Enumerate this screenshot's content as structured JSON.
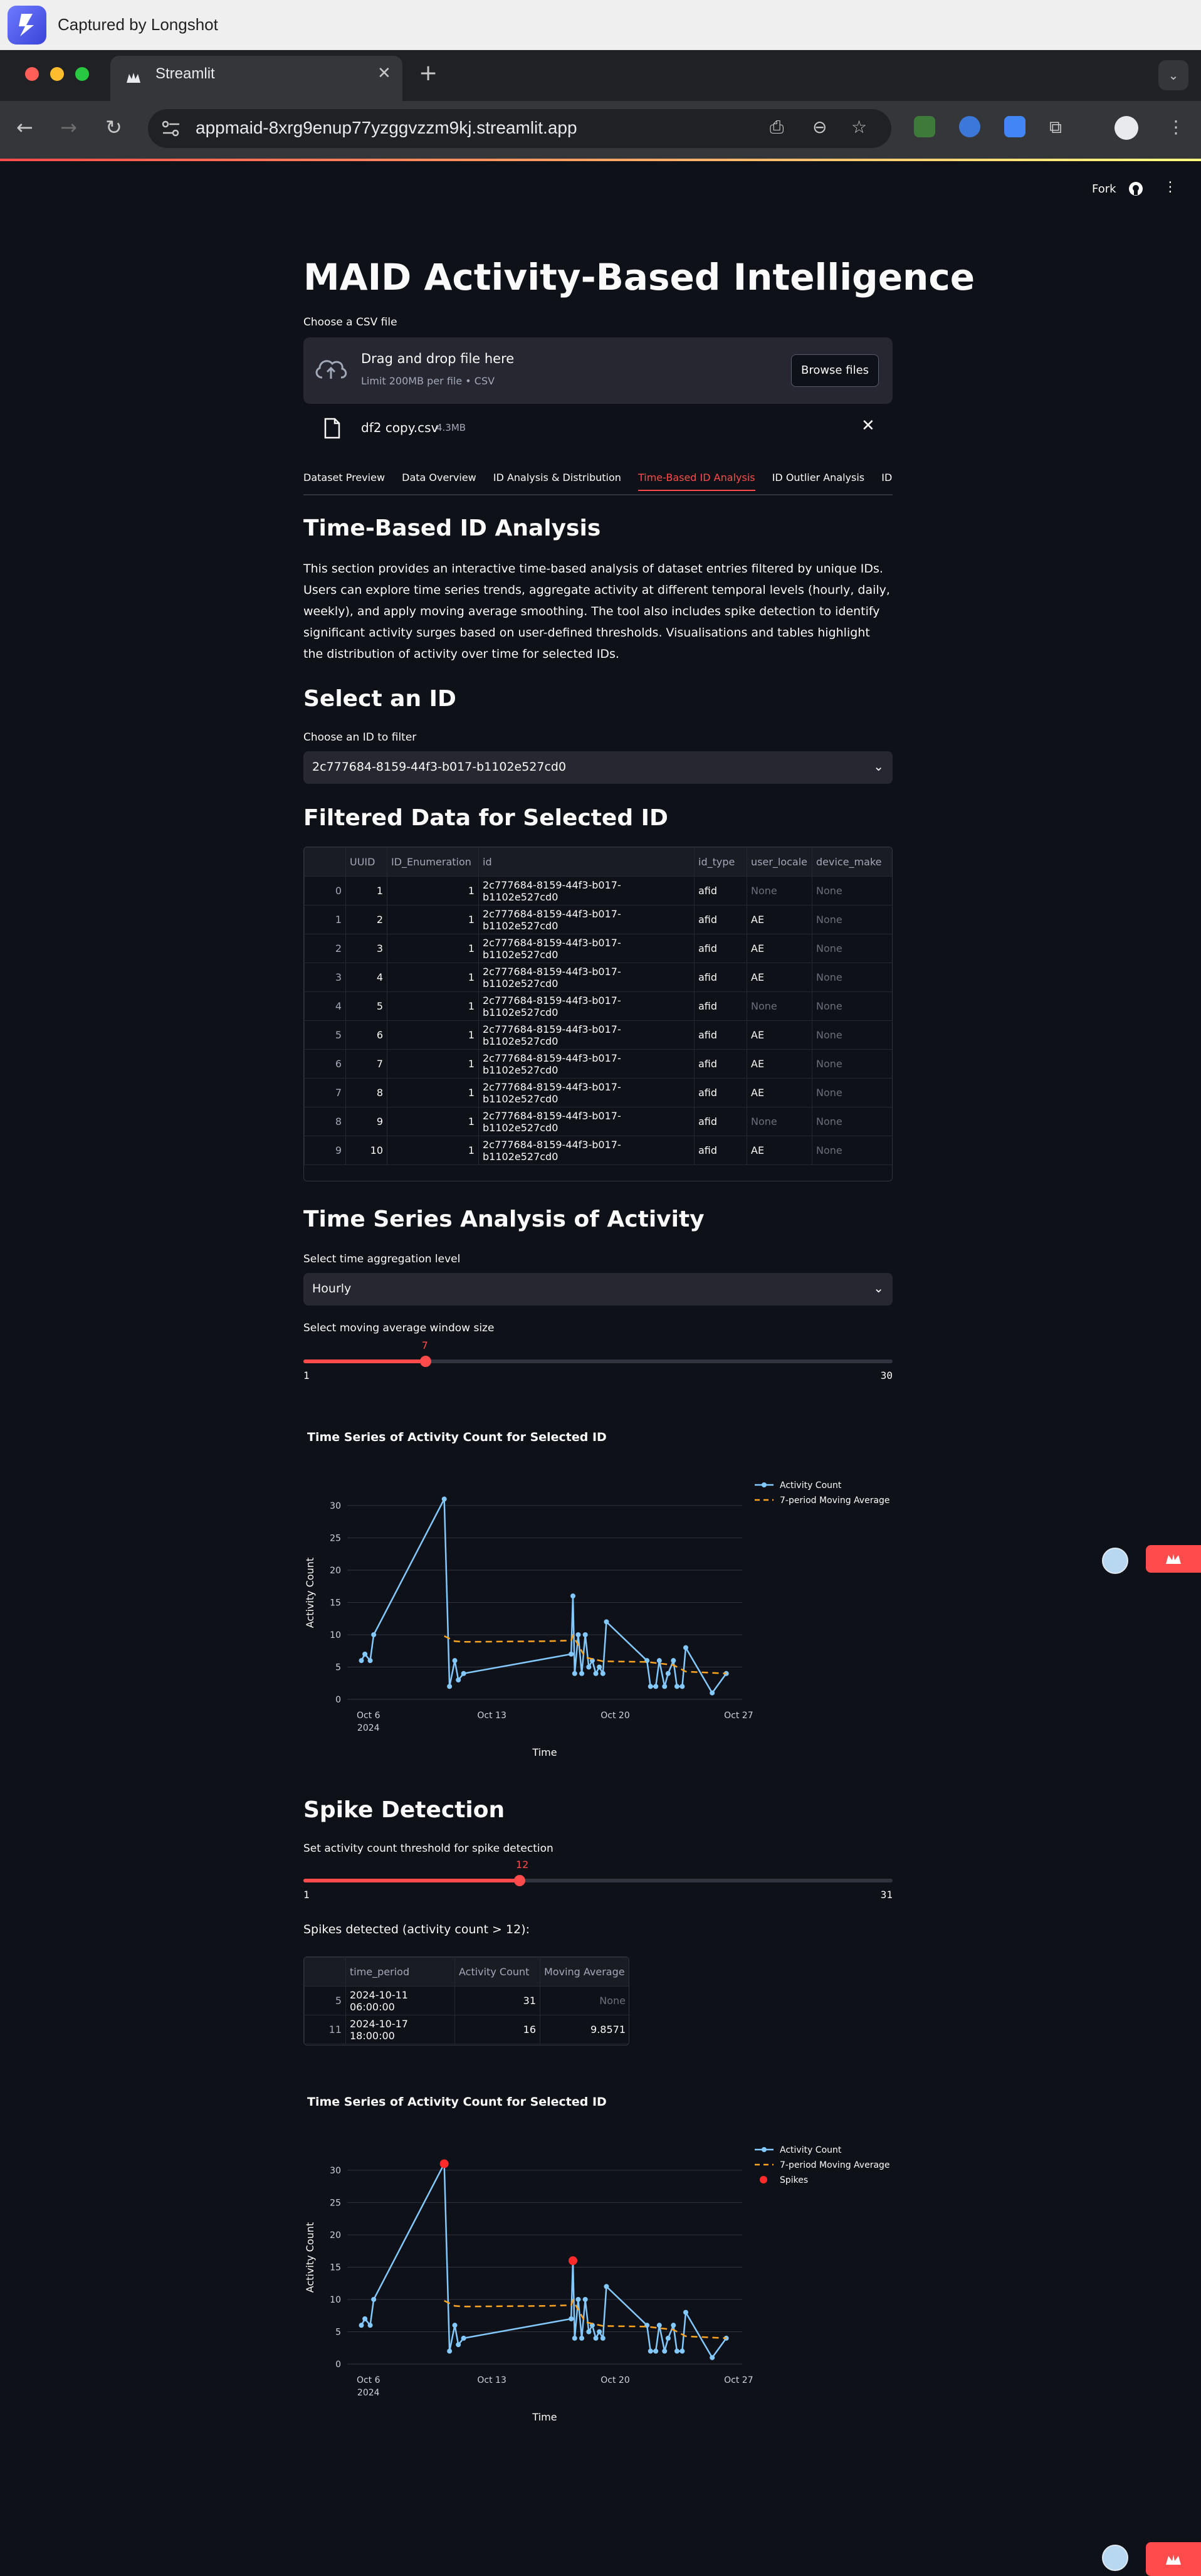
{
  "capture": {
    "title": "Captured by Longshot"
  },
  "browser": {
    "tab_title": "Streamlit",
    "new_tab": "+",
    "url": "appmaid-8xrg9enup77yzggvzzm9kj.streamlit.app"
  },
  "header": {
    "fork_label": "Fork",
    "menu_icon": "kebab-icon"
  },
  "page": {
    "title": "MAID Activity-Based Intelligence",
    "uploader": {
      "label": "Choose a CSV file",
      "drop_main": "Drag and drop file here",
      "drop_sub": "Limit 200MB per file • CSV",
      "browse": "Browse files",
      "file_name": "df2 copy.csv",
      "file_size": "4.3MB"
    },
    "tabs": [
      "Dataset Preview",
      "Data Overview",
      "ID Analysis & Distribution",
      "Time-Based ID Analysis",
      "ID Outlier Analysis",
      "ID Filter C"
    ],
    "active_tab": "Time-Based ID Analysis",
    "section_title": "Time-Based ID Analysis",
    "description": "This section provides an interactive time-based analysis of dataset entries filtered by unique IDs. Users can explore time series trends, aggregate activity at different temporal levels (hourly, daily, weekly), and apply moving average smoothing. The tool also includes spike detection to identify significant activity surges based on user-defined thresholds. Visualisations and tables highlight the distribution of activity over time for selected IDs.",
    "select_id": {
      "heading": "Select an ID",
      "label": "Choose an ID to filter",
      "value": "2c777684-8159-44f3-b017-b1102e527cd0"
    },
    "filtered": {
      "heading": "Filtered Data for Selected ID",
      "columns": [
        "",
        "UUID",
        "ID_Enumeration",
        "id",
        "id_type",
        "user_locale",
        "device_make"
      ],
      "rows": [
        [
          "0",
          "1",
          "1",
          "2c777684-8159-44f3-b017-b1102e527cd0",
          "afid",
          "None",
          "None"
        ],
        [
          "1",
          "2",
          "1",
          "2c777684-8159-44f3-b017-b1102e527cd0",
          "afid",
          "AE",
          "None"
        ],
        [
          "2",
          "3",
          "1",
          "2c777684-8159-44f3-b017-b1102e527cd0",
          "afid",
          "AE",
          "None"
        ],
        [
          "3",
          "4",
          "1",
          "2c777684-8159-44f3-b017-b1102e527cd0",
          "afid",
          "AE",
          "None"
        ],
        [
          "4",
          "5",
          "1",
          "2c777684-8159-44f3-b017-b1102e527cd0",
          "afid",
          "None",
          "None"
        ],
        [
          "5",
          "6",
          "1",
          "2c777684-8159-44f3-b017-b1102e527cd0",
          "afid",
          "AE",
          "None"
        ],
        [
          "6",
          "7",
          "1",
          "2c777684-8159-44f3-b017-b1102e527cd0",
          "afid",
          "AE",
          "None"
        ],
        [
          "7",
          "8",
          "1",
          "2c777684-8159-44f3-b017-b1102e527cd0",
          "afid",
          "AE",
          "None"
        ],
        [
          "8",
          "9",
          "1",
          "2c777684-8159-44f3-b017-b1102e527cd0",
          "afid",
          "None",
          "None"
        ],
        [
          "9",
          "10",
          "1",
          "2c777684-8159-44f3-b017-b1102e527cd0",
          "afid",
          "AE",
          "None"
        ]
      ]
    },
    "timeseries": {
      "heading": "Time Series Analysis of Activity",
      "agg_label": "Select time aggregation level",
      "agg_value": "Hourly",
      "ma_label": "Select moving average window size",
      "ma_value": "7",
      "ma_min": "1",
      "ma_max": "30",
      "ma_fraction": 0.207
    },
    "spike": {
      "heading": "Spike Detection",
      "threshold_label": "Set activity count threshold for spike detection",
      "threshold_value": "12",
      "threshold_min": "1",
      "threshold_max": "31",
      "threshold_fraction": 0.367,
      "detected_label": "Spikes detected (activity count > 12):",
      "columns": [
        "",
        "time_period",
        "Activity Count",
        "Moving Average"
      ],
      "rows": [
        [
          "5",
          "2024-10-11 06:00:00",
          "31",
          "None"
        ],
        [
          "11",
          "2024-10-17 18:00:00",
          "16",
          "9.8571"
        ]
      ]
    }
  },
  "chart_data": [
    {
      "type": "line",
      "title": "Time Series of Activity Count for Selected ID",
      "xlabel": "Time",
      "ylabel": "Activity Count",
      "x_ticks": [
        "Oct 6\n2024",
        "Oct 13",
        "Oct 20",
        "Oct 27"
      ],
      "x_tick_days": [
        6,
        13,
        20,
        27
      ],
      "ylim": [
        0,
        33
      ],
      "y_ticks": [
        0,
        5,
        10,
        15,
        20,
        25,
        30
      ],
      "grid": true,
      "legend": "top-right",
      "series": [
        {
          "name": "Activity Count",
          "color": "#83c9ff",
          "x": [
            5.6,
            5.8,
            6.1,
            6.3,
            10.3,
            10.6,
            10.9,
            11.1,
            11.4,
            17.5,
            17.6,
            17.7,
            17.9,
            18.1,
            18.3,
            18.5,
            18.7,
            18.9,
            19.1,
            19.3,
            19.5,
            21.8,
            22.0,
            22.3,
            22.5,
            22.8,
            23.0,
            23.3,
            23.5,
            23.8,
            24.0,
            25.5,
            26.3
          ],
          "values": [
            6,
            7,
            6,
            10,
            31,
            2,
            6,
            3,
            4,
            7,
            16,
            4,
            10,
            4,
            10,
            5,
            6,
            4,
            5,
            4,
            12,
            6,
            2,
            2,
            6,
            2,
            4,
            6,
            2,
            2,
            8,
            1,
            4
          ]
        },
        {
          "name": "7-period Moving Average",
          "color": "#ffa421",
          "x": [
            10.3,
            10.9,
            11.4,
            16.0,
            17.5,
            17.6,
            18.3,
            19.3,
            21.8,
            23.3,
            24.0,
            26.3
          ],
          "values": [
            9.8,
            9,
            8.9,
            9,
            9.1,
            9.86,
            6.5,
            5.9,
            5.8,
            5.3,
            4.3,
            4
          ]
        }
      ]
    },
    {
      "type": "line",
      "title": "Time Series of Activity Count for Selected ID",
      "xlabel": "Time",
      "ylabel": "Activity Count",
      "x_ticks": [
        "Oct 6\n2024",
        "Oct 13",
        "Oct 20",
        "Oct 27"
      ],
      "x_tick_days": [
        6,
        13,
        20,
        27
      ],
      "ylim": [
        0,
        33
      ],
      "y_ticks": [
        0,
        5,
        10,
        15,
        20,
        25,
        30
      ],
      "grid": true,
      "legend": "top-right",
      "series": [
        {
          "name": "Activity Count",
          "color": "#83c9ff",
          "x": [
            5.6,
            5.8,
            6.1,
            6.3,
            10.3,
            10.6,
            10.9,
            11.1,
            11.4,
            17.5,
            17.6,
            17.7,
            17.9,
            18.1,
            18.3,
            18.5,
            18.7,
            18.9,
            19.1,
            19.3,
            19.5,
            21.8,
            22.0,
            22.3,
            22.5,
            22.8,
            23.0,
            23.3,
            23.5,
            23.8,
            24.0,
            25.5,
            26.3
          ],
          "values": [
            6,
            7,
            6,
            10,
            31,
            2,
            6,
            3,
            4,
            7,
            16,
            4,
            10,
            4,
            10,
            5,
            6,
            4,
            5,
            4,
            12,
            6,
            2,
            2,
            6,
            2,
            4,
            6,
            2,
            2,
            8,
            1,
            4
          ]
        },
        {
          "name": "7-period Moving Average",
          "color": "#ffa421",
          "x": [
            10.3,
            10.9,
            11.4,
            16.0,
            17.5,
            17.6,
            18.3,
            19.3,
            21.8,
            23.3,
            24.0,
            26.3
          ],
          "values": [
            9.8,
            9,
            8.9,
            9,
            9.1,
            9.86,
            6.5,
            5.9,
            5.8,
            5.3,
            4.3,
            4
          ]
        },
        {
          "name": "Spikes",
          "color": "#ff2b2b",
          "x": [
            10.3,
            17.6
          ],
          "values": [
            31,
            16
          ]
        }
      ]
    }
  ]
}
